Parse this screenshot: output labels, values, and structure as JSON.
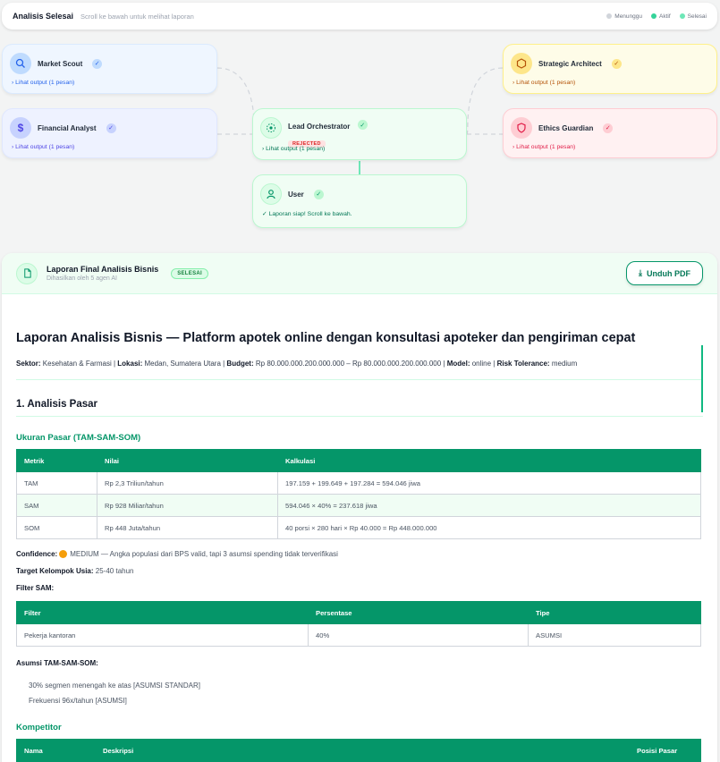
{
  "header": {
    "title": "Analisis Selesai",
    "subtitle": "Scroll ke bawah untuk melihat laporan",
    "legend": [
      {
        "label": "Menunggu",
        "color": "#d1d5db"
      },
      {
        "label": "Aktif",
        "color": "#34d399"
      },
      {
        "label": "Selesai",
        "color": "#6ee7b7"
      }
    ]
  },
  "agents": {
    "market_scout": {
      "name": "Market Scout",
      "output": "Lihat output (1 pesan)",
      "icon": "search-icon"
    },
    "financial_analyst": {
      "name": "Financial Analyst",
      "output": "Lihat output (1 pesan)",
      "icon": "dollar-icon"
    },
    "lead_orchestrator": {
      "name": "Lead Orchestrator",
      "badge": "REJECTED",
      "output": "Lihat output (1 pesan)",
      "icon": "network-icon"
    },
    "user": {
      "name": "User",
      "message": "Laporan siap! Scroll ke bawah.",
      "icon": "user-icon"
    },
    "strategic_architect": {
      "name": "Strategic Architect",
      "output": "Lihat output (1 pesan)",
      "icon": "hexagon-icon"
    },
    "ethics_guardian": {
      "name": "Ethics Guardian",
      "output": "Lihat output (1 pesan)",
      "icon": "shield-icon"
    }
  },
  "report": {
    "title": "Laporan Final Analisis Bisnis",
    "subtitle": "Dihasilkan oleh 5 agen AI",
    "status": "SELESAI",
    "download_label": "Unduh PDF",
    "heading": "Laporan Analisis Bisnis — Platform apotek online dengan konsultasi apoteker dan pengiriman cepat",
    "meta": {
      "sektor_label": "Sektor:",
      "sektor": "Kesehatan & Farmasi",
      "lokasi_label": "Lokasi:",
      "lokasi": "Medan, Sumatera Utara",
      "budget_label": "Budget:",
      "budget": "Rp 80.000.000.200.000.000 – Rp 80.000.000.200.000.000",
      "model_label": "Model:",
      "model": "online",
      "risk_label": "Risk Tolerance:",
      "risk": "medium"
    },
    "section1": "1. Analisis Pasar",
    "market_size_title": "Ukuran Pasar (TAM-SAM-SOM)",
    "market_table": {
      "headers": [
        "Metrik",
        "Nilai",
        "Kalkulasi"
      ],
      "rows": [
        [
          "TAM",
          "Rp 2,3 Triliun/tahun",
          "197.159 + 199.649 + 197.284 = 594.046 jiwa"
        ],
        [
          "SAM",
          "Rp 928 Miliar/tahun",
          "594.046 × 40% = 237.618 jiwa"
        ],
        [
          "SOM",
          "Rp 448 Juta/tahun",
          "40 porsi × 280 hari × Rp 40.000 = Rp 448.000.000"
        ]
      ]
    },
    "confidence_label": "Confidence:",
    "confidence_text": "MEDIUM — Angka populasi dari BPS valid, tapi 3 asumsi spending tidak terverifikasi",
    "target_label": "Target Kelompok Usia:",
    "target_value": "25-40 tahun",
    "filter_label": "Filter SAM:",
    "filter_table": {
      "headers": [
        "Filter",
        "Persentase",
        "Tipe"
      ],
      "rows": [
        [
          "Pekerja kantoran",
          "40%",
          "ASUMSI"
        ]
      ]
    },
    "assumption_label": "Asumsi TAM-SAM-SOM:",
    "assumptions": [
      "30% segmen menengah ke atas [ASUMSI STANDAR]",
      "Frekuensi 96x/tahun [ASUMSI]"
    ],
    "competitor_title": "Kompetitor",
    "competitor_headers": [
      "Nama",
      "Deskripsi",
      "Posisi Pasar"
    ]
  }
}
